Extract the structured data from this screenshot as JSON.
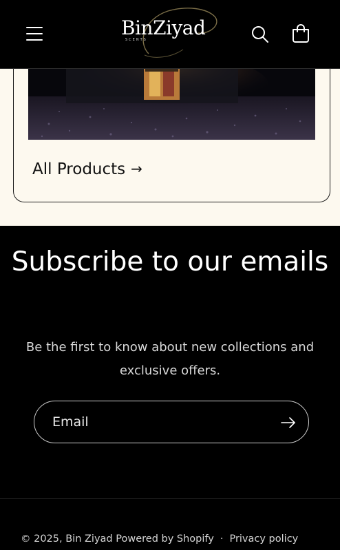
{
  "header": {
    "logo_text": "BinZiyad",
    "logo_sub": "SCENTS",
    "icons": {
      "menu": "hamburger-menu-icon",
      "search": "search-icon",
      "cart": "shopping-bag-icon"
    }
  },
  "collection": {
    "link_label": "All Products",
    "link_arrow": "→"
  },
  "newsletter": {
    "title": "Subscribe to our emails",
    "description": "Be the first to know about new collections and exclusive offers.",
    "email_placeholder": "Email",
    "submit_icon": "arrow-right-icon"
  },
  "footer": {
    "copyright": "© 2025, Bin Ziyad",
    "powered_by": "Powered by Shopify",
    "separator": "·",
    "privacy": "Privacy policy"
  },
  "colors": {
    "background": "#000000",
    "cream": "#fdf9ef",
    "text": "#ffffff"
  }
}
